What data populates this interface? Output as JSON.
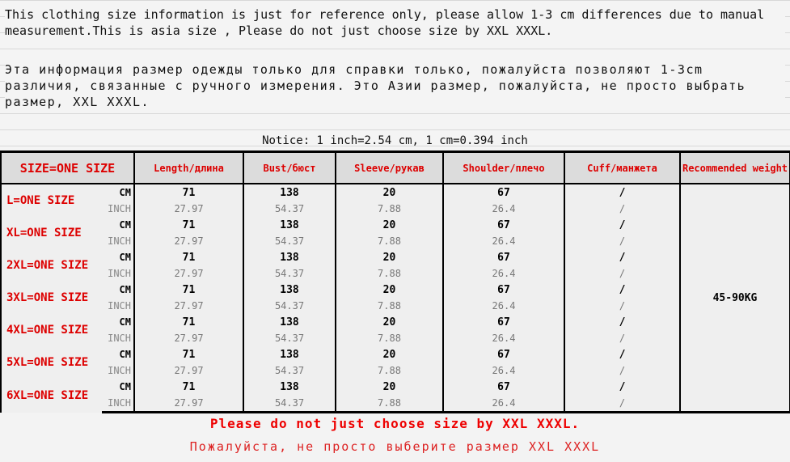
{
  "intro": {
    "en": "      This clothing size information is just for reference only, please allow 1-3 cm differences due to manual measurement.This is asia size , Please do not just choose size by XXL XXXL.",
    "ru": "      Эта информация размер одежды только для справки только, пожалуйста позволяют 1-3cm различия, связанные с ручного измерения. Это Азии размер, пожалуйста, не просто выбрать размер, XXL XXXL.",
    "notice": "Notice: 1 inch=2.54 cm, 1 cm=0.394 inch"
  },
  "table": {
    "headers": [
      "SIZE=ONE SIZE",
      "Length/длина",
      "Bust/бюст",
      "Sleeve/рукав",
      "Shoulder/плечо",
      "Cuff/манжета",
      "Recommended weight"
    ],
    "unit_cm": "CM",
    "unit_inch": "INCH",
    "weight": "45-90KG",
    "rows": [
      {
        "size": "L=ONE SIZE",
        "cm": [
          "71",
          "138",
          "20",
          "67",
          "/"
        ],
        "inch": [
          "27.97",
          "54.37",
          "7.88",
          "26.4",
          "/"
        ]
      },
      {
        "size": "XL=ONE SIZE",
        "cm": [
          "71",
          "138",
          "20",
          "67",
          "/"
        ],
        "inch": [
          "27.97",
          "54.37",
          "7.88",
          "26.4",
          "/"
        ]
      },
      {
        "size": "2XL=ONE SIZE",
        "cm": [
          "71",
          "138",
          "20",
          "67",
          "/"
        ],
        "inch": [
          "27.97",
          "54.37",
          "7.88",
          "26.4",
          "/"
        ]
      },
      {
        "size": "3XL=ONE SIZE",
        "cm": [
          "71",
          "138",
          "20",
          "67",
          "/"
        ],
        "inch": [
          "27.97",
          "54.37",
          "7.88",
          "26.4",
          "/"
        ]
      },
      {
        "size": "4XL=ONE SIZE",
        "cm": [
          "71",
          "138",
          "20",
          "67",
          "/"
        ],
        "inch": [
          "27.97",
          "54.37",
          "7.88",
          "26.4",
          "/"
        ]
      },
      {
        "size": "5XL=ONE SIZE",
        "cm": [
          "71",
          "138",
          "20",
          "67",
          "/"
        ],
        "inch": [
          "27.97",
          "54.37",
          "7.88",
          "26.4",
          "/"
        ]
      },
      {
        "size": "6XL=ONE SIZE",
        "cm": [
          "71",
          "138",
          "20",
          "67",
          "/"
        ],
        "inch": [
          "27.97",
          "54.37",
          "7.88",
          "26.4",
          "/"
        ]
      }
    ]
  },
  "footer": {
    "en": "Please do not just choose size by XXL XXXL.",
    "ru": "Пожалуйста, не просто выберите размер XXL XXXL"
  }
}
